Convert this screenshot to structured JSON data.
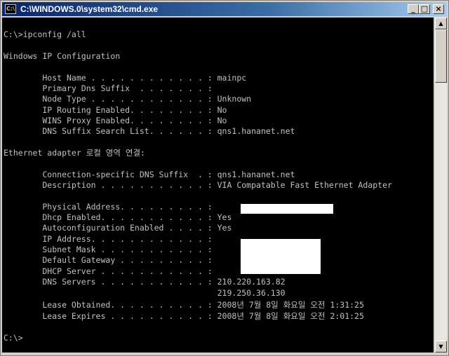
{
  "window": {
    "title": "C:\\WINDOWS.0\\system32\\cmd.exe",
    "icon_label": "C:\\"
  },
  "controls": {
    "minimize": "_",
    "maximize": "□",
    "close": "×"
  },
  "console": {
    "lines": [
      "",
      "C:\\>ipconfig /all",
      "",
      "Windows IP Configuration",
      "",
      "        Host Name . . . . . . . . . . . . : mainpc",
      "        Primary Dns Suffix  . . . . . . . :",
      "        Node Type . . . . . . . . . . . . : Unknown",
      "        IP Routing Enabled. . . . . . . . : No",
      "        WINS Proxy Enabled. . . . . . . . : No",
      "        DNS Suffix Search List. . . . . . : qns1.hananet.net",
      "",
      "Ethernet adapter 로컬 영역 연결:",
      "",
      "        Connection-specific DNS Suffix  . : qns1.hananet.net",
      "        Description . . . . . . . . . . . : VIA Compatable Fast Ethernet Adapter",
      "",
      "        Physical Address. . . . . . . . . :",
      "        Dhcp Enabled. . . . . . . . . . . : Yes",
      "        Autoconfiguration Enabled . . . . : Yes",
      "        IP Address. . . . . . . . . . . . :",
      "        Subnet Mask . . . . . . . . . . . :",
      "        Default Gateway . . . . . . . . . :",
      "        DHCP Server . . . . . . . . . . . :",
      "        DNS Servers . . . . . . . . . . . : 210.220.163.82",
      "                                            219.250.36.130",
      "        Lease Obtained. . . . . . . . . . : 2008년 7월 8일 화요일 오전 1:31:25",
      "        Lease Expires . . . . . . . . . . : 2008년 7월 8일 화요일 오전 2:01:25",
      "",
      "C:\\>"
    ]
  },
  "scrollbar": {
    "up_arrow": "▲",
    "down_arrow": "▼"
  }
}
